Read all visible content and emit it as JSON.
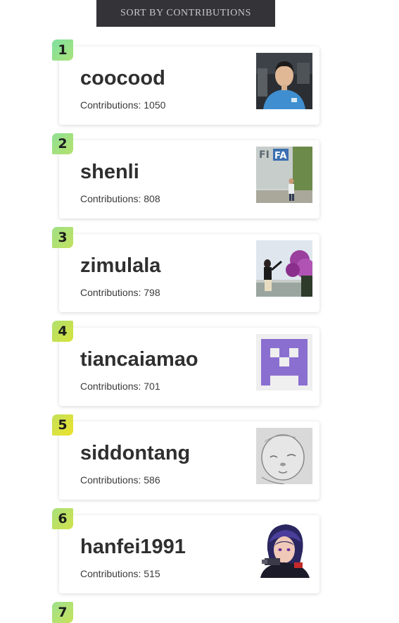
{
  "sort_button_label": "SORT BY CONTRIBUTIONS",
  "contributors": [
    {
      "rank": "1",
      "username": "coocood",
      "contributions_text": "Contributions: 1050",
      "badge_color": "#8fe08f"
    },
    {
      "rank": "2",
      "username": "shenli",
      "contributions_text": "Contributions: 808",
      "badge_color": "#9ee082"
    },
    {
      "rank": "3",
      "username": "zimulala",
      "contributions_text": "Contributions: 798",
      "badge_color": "#ade078"
    },
    {
      "rank": "4",
      "username": "tiancaiamao",
      "contributions_text": "Contributions: 701",
      "badge_color": "#bde05e"
    },
    {
      "rank": "5",
      "username": "siddontang",
      "contributions_text": "Contributions: 586",
      "badge_color": "#d2e33e"
    },
    {
      "rank": "6",
      "username": "hanfei1991",
      "contributions_text": "Contributions: 515",
      "badge_color": "#b7e26a"
    }
  ],
  "next_rank": "7"
}
